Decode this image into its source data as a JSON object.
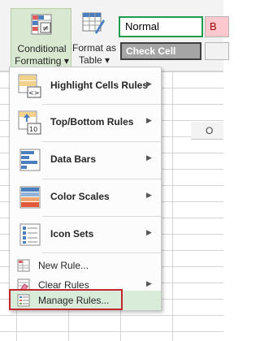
{
  "ribbon": {
    "conditional_formatting_line1": "Conditional",
    "conditional_formatting_line2": "Formatting",
    "format_as_table_line1": "Format as",
    "format_as_table_line2": "Table",
    "style_normal": "Normal",
    "style_check_cell": "Check Cell",
    "style_bad_fragment": "B"
  },
  "sheet": {
    "column_header": "O"
  },
  "menu": {
    "items": [
      {
        "label": "Highlight Cells Rules",
        "icon": "highlight-cells-icon",
        "submenu": true
      },
      {
        "label": "Top/Bottom Rules",
        "icon": "top-bottom-icon",
        "submenu": true
      },
      {
        "label": "Data Bars",
        "icon": "data-bars-icon",
        "submenu": true
      },
      {
        "label": "Color Scales",
        "icon": "color-scales-icon",
        "submenu": true
      },
      {
        "label": "Icon Sets",
        "icon": "icon-sets-icon",
        "submenu": true
      }
    ],
    "small_items": [
      {
        "label": "New Rule...",
        "icon": "new-rule-icon",
        "submenu": false
      },
      {
        "label": "Clear Rules",
        "icon": "clear-rules-icon",
        "submenu": true
      },
      {
        "label": "Manage Rules...",
        "icon": "manage-rules-icon",
        "submenu": false
      }
    ],
    "arrow_glyph": "▶",
    "dropdown_glyph": "▾"
  },
  "colors": {
    "ribbon_selected": "#d9e8d1",
    "highlight_row": "#d9ecd9",
    "annotation_box": "#c1272d",
    "style_normal_border": "#1e9c4f",
    "check_cell_fill": "#a5a5a5",
    "bad_fill": "#ffc7ce"
  }
}
